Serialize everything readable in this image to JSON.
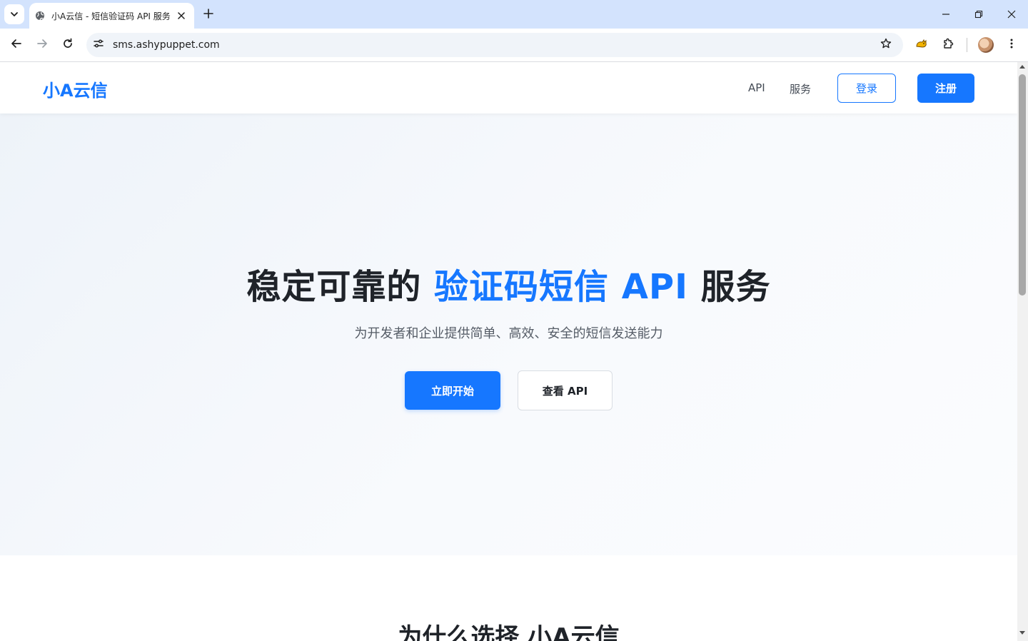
{
  "browser": {
    "tab_title": "小A云信 - 短信验证码 API 服务",
    "url": "sms.ashypuppet.com",
    "icons": {
      "tab_search": "chevron-down-icon",
      "favicon": "globe-icon",
      "tab_close": "close-icon",
      "new_tab": "plus-icon",
      "back": "arrow-left-icon",
      "forward": "arrow-right-icon",
      "reload": "reload-icon",
      "site_info": "tune-icon",
      "bookmark": "star-icon",
      "extension_pet": "cat-icon",
      "extensions": "puzzle-icon",
      "menu": "kebab-menu-icon"
    }
  },
  "header": {
    "logo": "小A云信",
    "nav": [
      {
        "label": "API"
      },
      {
        "label": "服务"
      }
    ],
    "login_label": "登录",
    "signup_label": "注册"
  },
  "hero": {
    "title_part1": "稳定可靠的 ",
    "title_highlight": "验证码短信 API",
    "title_part2": " 服务",
    "subtitle": "为开发者和企业提供简单、高效、安全的短信发送能力",
    "primary_button": "立即开始",
    "secondary_button": "查看 API"
  },
  "features": {
    "title": "为什么选择 小A云信"
  },
  "colors": {
    "accent": "#1677ff",
    "text_dark": "#1f2329",
    "hero_bg": "#f4f7fb",
    "chrome_tabstrip": "#d3e3fd"
  }
}
